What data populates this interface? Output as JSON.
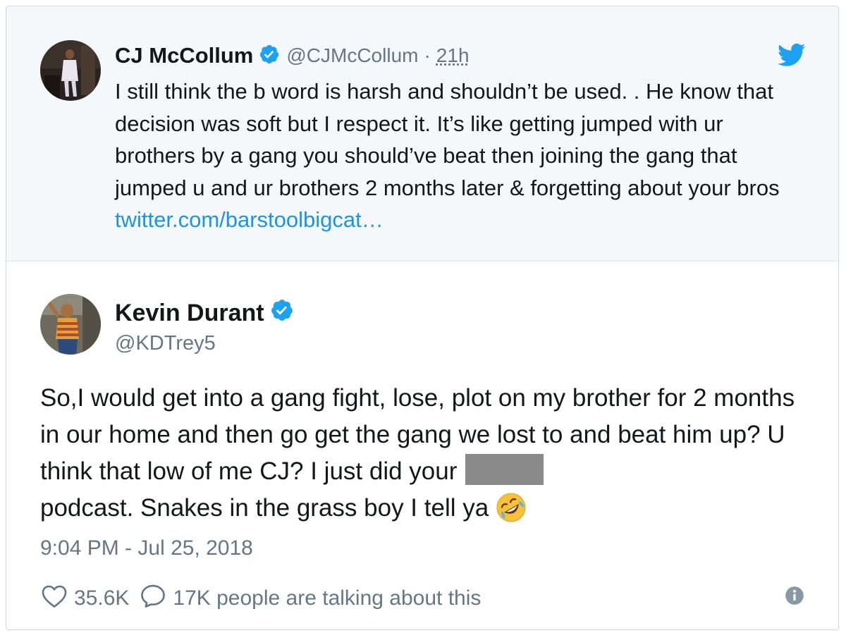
{
  "quoted_tweet": {
    "name": "CJ McCollum",
    "handle": "@CJMcCollum",
    "separator": "·",
    "time": "21h",
    "text": "I still think the b word is harsh and shouldn’t be used. . He know that decision was soft but I respect it. It’s like getting jumped with ur brothers by a gang you should’ve beat then joining the gang that jumped u and ur brothers 2 months later & forgetting about your bros ",
    "link": "twitter.com/barstoolbigcat…",
    "avatar_icon": "avatar-photo-cj",
    "verified_icon": "verified-badge-icon",
    "brand_icon": "twitter-bird-icon"
  },
  "main_tweet": {
    "name": "Kevin Durant",
    "handle": "@KDTrey5",
    "text_part1": "So,I would get into a gang fight, lose, plot on my brother for 2 months in our home and then go get the gang we lost to and beat him up? U think that low of me CJ? I just did your",
    "text_part2": " podcast. Snakes in the grass boy I tell ya",
    "emoji_icon": "rolling-on-floor-laughing-emoji",
    "date": "9:04 PM - Jul 25, 2018",
    "likes": "35.6K",
    "talking": "17K people are talking about this",
    "avatar_icon": "avatar-photo-kd"
  },
  "colors": {
    "link": "#1b95e0",
    "verified": "#1da1f2",
    "muted": "#657786",
    "quoted_bg": "#f5f8fa",
    "redaction": "#8a8a8a"
  }
}
